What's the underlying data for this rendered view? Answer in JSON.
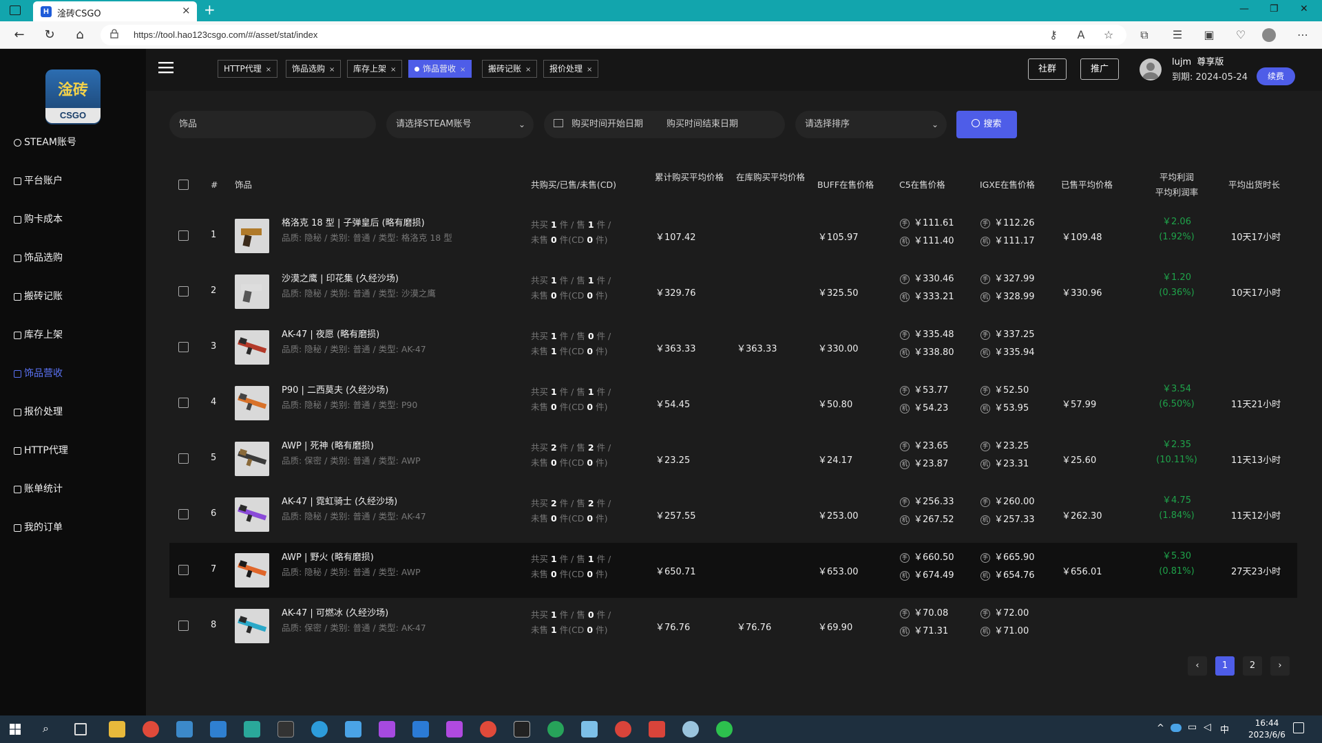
{
  "browser": {
    "tab_title": "淦砖CSGO",
    "tab_favicon": "H",
    "url": "https://tool.hao123csgo.com/#/asset/stat/index"
  },
  "sidebar": {
    "logo_main": "淦砖",
    "logo_sub": "CSGO",
    "items": [
      {
        "label": "STEAM账号",
        "icon": "steam-icon"
      },
      {
        "label": "平台账户",
        "icon": "users-icon"
      },
      {
        "label": "购卡成本",
        "icon": "card-icon"
      },
      {
        "label": "饰品选购",
        "icon": "cart-icon"
      },
      {
        "label": "搬砖记账",
        "icon": "book-icon"
      },
      {
        "label": "库存上架",
        "icon": "upload-icon"
      },
      {
        "label": "饰品营收",
        "icon": "revenue-icon",
        "active": true
      },
      {
        "label": "报价处理",
        "icon": "doc-icon"
      },
      {
        "label": "HTTP代理",
        "icon": "proxy-icon"
      },
      {
        "label": "账单统计",
        "icon": "chart-icon"
      },
      {
        "label": "我的订单",
        "icon": "order-icon"
      }
    ]
  },
  "page_tabs": [
    {
      "label": "HTTP代理"
    },
    {
      "label": "饰品选购"
    },
    {
      "label": "库存上架"
    },
    {
      "label": "饰品营收",
      "active": true
    },
    {
      "label": "搬砖记账"
    },
    {
      "label": "报价处理"
    }
  ],
  "header": {
    "community_btn": "社群",
    "promote_btn": "推广",
    "user_name": "lujm",
    "user_level": "尊享版",
    "expire_label": "到期:",
    "expire_date": "2024-05-24",
    "renew_btn": "续费"
  },
  "filters": {
    "item_placeholder": "饰品",
    "steam_placeholder": "请选择STEAM账号",
    "start_date_placeholder": "购买时间开始日期",
    "end_date_placeholder": "购买时间结束日期",
    "sort_placeholder": "请选择排序",
    "search_btn": "搜索"
  },
  "table": {
    "headers": {
      "index": "#",
      "item": "饰品",
      "counts": "共购买/已售/未售(CD)",
      "avg_buy": "累计购买平均价格",
      "avg_stock": "在库购买平均价格",
      "buff": "BUFF在售价格",
      "c5": "C5在售价格",
      "igxe": "IGXE在售价格",
      "avg_sold": "已售平均价格",
      "profit": "平均利润",
      "profit_rate": "平均利润率",
      "avg_time": "平均出货时长"
    },
    "rows": [
      {
        "idx": "1",
        "name": "格洛克 18 型 | 子弹皇后 (略有磨损)",
        "attrs": "品质: 隐秘 / 类别: 普通 / 类型: 格洛克 18 型",
        "bought": "1",
        "sold": "1",
        "unsold": "0",
        "cd": "0",
        "avg_buy": "￥107.42",
        "avg_stock": "",
        "buff": "￥105.97",
        "c5_a": "￥111.61",
        "c5_b": "￥111.40",
        "igxe_a": "￥112.26",
        "igxe_b": "￥111.17",
        "avg_sold": "￥109.48",
        "profit": "￥2.06",
        "profit_rate": "(1.92%)",
        "avg_time": "10天17小时",
        "thumb": "pistol-gold"
      },
      {
        "idx": "2",
        "name": "沙漠之鹰 | 印花集 (久经沙场)",
        "attrs": "品质: 隐秘 / 类别: 普通 / 类型: 沙漠之鹰",
        "bought": "1",
        "sold": "1",
        "unsold": "0",
        "cd": "0",
        "avg_buy": "￥329.76",
        "avg_stock": "",
        "buff": "￥325.50",
        "c5_a": "￥330.46",
        "c5_b": "￥333.21",
        "igxe_a": "￥327.99",
        "igxe_b": "￥328.99",
        "avg_sold": "￥330.96",
        "profit": "￥1.20",
        "profit_rate": "(0.36%)",
        "avg_time": "10天17小时",
        "thumb": "pistol-white"
      },
      {
        "idx": "3",
        "name": "AK-47 | 夜愿 (略有磨损)",
        "attrs": "品质: 隐秘 / 类别: 普通 / 类型: AK-47",
        "bought": "1",
        "sold": "0",
        "unsold": "1",
        "cd": "0",
        "avg_buy": "￥363.33",
        "avg_stock": "￥363.33",
        "buff": "￥330.00",
        "c5_a": "￥335.48",
        "c5_b": "￥338.80",
        "igxe_a": "￥337.25",
        "igxe_b": "￥335.94",
        "avg_sold": "",
        "profit": "",
        "profit_rate": "",
        "avg_time": "",
        "thumb": "rifle-red"
      },
      {
        "idx": "4",
        "name": "P90 | 二西莫夫 (久经沙场)",
        "attrs": "品质: 隐秘 / 类别: 普通 / 类型: P90",
        "bought": "1",
        "sold": "1",
        "unsold": "0",
        "cd": "0",
        "avg_buy": "￥54.45",
        "avg_stock": "",
        "buff": "￥50.80",
        "c5_a": "￥53.77",
        "c5_b": "￥54.23",
        "igxe_a": "￥52.50",
        "igxe_b": "￥53.95",
        "avg_sold": "￥57.99",
        "profit": "￥3.54",
        "profit_rate": "(6.50%)",
        "avg_time": "11天21小时",
        "thumb": "smg-orange"
      },
      {
        "idx": "5",
        "name": "AWP | 死神 (略有磨损)",
        "attrs": "品质: 保密 / 类别: 普通 / 类型: AWP",
        "bought": "2",
        "sold": "2",
        "unsold": "0",
        "cd": "0",
        "avg_buy": "￥23.25",
        "avg_stock": "",
        "buff": "￥24.17",
        "c5_a": "￥23.65",
        "c5_b": "￥23.87",
        "igxe_a": "￥23.25",
        "igxe_b": "￥23.31",
        "avg_sold": "￥25.60",
        "profit": "￥2.35",
        "profit_rate": "(10.11%)",
        "avg_time": "11天13小时",
        "thumb": "sniper-dark"
      },
      {
        "idx": "6",
        "name": "AK-47 | 霓虹骑士 (久经沙场)",
        "attrs": "品质: 隐秘 / 类别: 普通 / 类型: AK-47",
        "bought": "2",
        "sold": "2",
        "unsold": "0",
        "cd": "0",
        "avg_buy": "￥257.55",
        "avg_stock": "",
        "buff": "￥253.00",
        "c5_a": "￥256.33",
        "c5_b": "￥267.52",
        "igxe_a": "￥260.00",
        "igxe_b": "￥257.33",
        "avg_sold": "￥262.30",
        "profit": "￥4.75",
        "profit_rate": "(1.84%)",
        "avg_time": "11天12小时",
        "thumb": "rifle-purple"
      },
      {
        "idx": "7",
        "name": "AWP | 野火 (略有磨损)",
        "attrs": "品质: 隐秘 / 类别: 普通 / 类型: AWP",
        "bought": "1",
        "sold": "1",
        "unsold": "0",
        "cd": "0",
        "avg_buy": "￥650.71",
        "avg_stock": "",
        "buff": "￥653.00",
        "c5_a": "￥660.50",
        "c5_b": "￥674.49",
        "igxe_a": "￥665.90",
        "igxe_b": "￥654.76",
        "avg_sold": "￥656.01",
        "profit": "￥5.30",
        "profit_rate": "(0.81%)",
        "avg_time": "27天23小时",
        "thumb": "sniper-fire",
        "highlight": true
      },
      {
        "idx": "8",
        "name": "AK-47 | 可燃冰 (久经沙场)",
        "attrs": "品质: 保密 / 类别: 普通 / 类型: AK-47",
        "bought": "1",
        "sold": "0",
        "unsold": "1",
        "cd": "0",
        "avg_buy": "￥76.76",
        "avg_stock": "￥76.76",
        "buff": "￥69.90",
        "c5_a": "￥70.08",
        "c5_b": "￥71.31",
        "igxe_a": "￥72.00",
        "igxe_b": "￥71.00",
        "avg_sold": "",
        "profit": "",
        "profit_rate": "",
        "avg_time": "",
        "thumb": "rifle-cyan"
      }
    ],
    "labels": {
      "total_buy": "共买",
      "piece": "件",
      "sell": "售",
      "unsold": "未售",
      "cd": "件(CD",
      "cd_end": "件)",
      "c5_mark_a": "手",
      "c5_mark_b": "机",
      "igxe_mark_a": "手",
      "igxe_mark_b": "机"
    }
  },
  "pagination": {
    "pages": [
      "1",
      "2"
    ],
    "current": "1"
  },
  "taskbar": {
    "time": "16:44",
    "date": "2023/6/6",
    "ime": "中"
  },
  "colors": {
    "accent": "#4e5de8",
    "profit": "#1fa34a",
    "titlebar": "#12a5ad"
  }
}
